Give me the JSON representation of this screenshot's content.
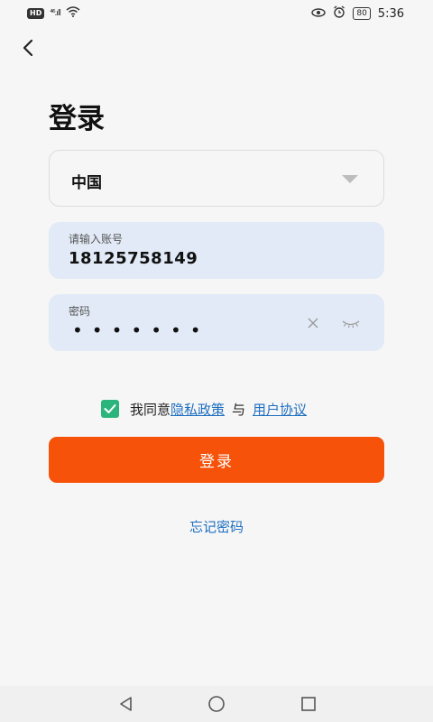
{
  "status_bar": {
    "hd_badge": "HD",
    "signal_text": "⁴⁶.ıll",
    "battery": "80",
    "time": "5:36"
  },
  "header": {
    "title": "登录"
  },
  "region_select": {
    "value": "中国"
  },
  "account_field": {
    "label": "请输入账号",
    "value": "18125758149"
  },
  "password_field": {
    "label": "密码",
    "masked_value": "•••••••"
  },
  "agreement": {
    "checked": true,
    "prefix": "我同意",
    "privacy_link": "隐私政策",
    "conjunction": "与",
    "terms_link": "用户协议"
  },
  "actions": {
    "login_label": "登录",
    "forgot_label": "忘记密码"
  },
  "icons": {
    "back": "back-arrow-icon",
    "clear": "close-icon",
    "eye": "eye-closed-icon",
    "checkbox": "check-icon"
  },
  "colors": {
    "primary": "#f6520a",
    "link": "#1e6fc0",
    "checkbox": "#2bb57c",
    "field_bg": "#e1eaf6"
  }
}
